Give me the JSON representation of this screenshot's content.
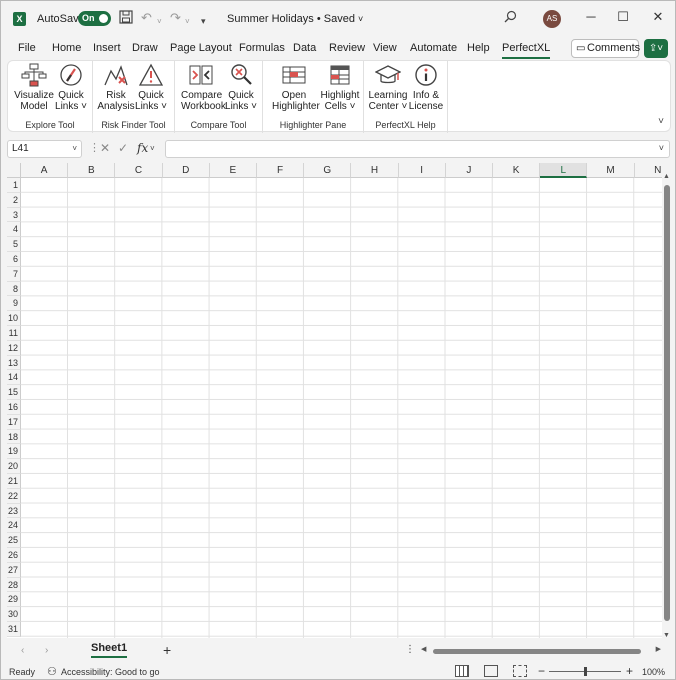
{
  "titlebar": {
    "app_icon": "X",
    "autosave_label": "AutoSave",
    "autosave_state": "On",
    "doc_title": "Summer Holidays • Saved",
    "avatar_initials": "AS",
    "icons": [
      "save-icon",
      "undo-icon",
      "redo-icon",
      "customize-icon",
      "search-icon"
    ]
  },
  "menu": {
    "tabs": [
      "File",
      "Home",
      "Insert",
      "Draw",
      "Page Layout",
      "Formulas",
      "Data",
      "Review",
      "View",
      "Automate",
      "Help",
      "PerfectXL"
    ],
    "active_tab": "PerfectXL",
    "comments_label": "Comments"
  },
  "ribbon": {
    "groups": [
      {
        "label": "Explore Tool",
        "buttons": [
          {
            "line1": "Visualize",
            "line2": "Model",
            "icon": "visualize-model-icon"
          },
          {
            "line1": "Quick",
            "line2": "Links ˅",
            "icon": "compass-icon"
          }
        ]
      },
      {
        "label": "Risk Finder Tool",
        "buttons": [
          {
            "line1": "Risk",
            "line2": "Analysis",
            "icon": "risk-analysis-icon"
          },
          {
            "line1": "Quick",
            "line2": "Links ˅",
            "icon": "warning-icon"
          }
        ]
      },
      {
        "label": "Compare Tool",
        "buttons": [
          {
            "line1": "Compare",
            "line2": "Workbook",
            "icon": "compare-workbook-icon"
          },
          {
            "line1": "Quick",
            "line2": "Links ˅",
            "icon": "magnifier-icon"
          }
        ]
      },
      {
        "label": "Highlighter Pane",
        "buttons": [
          {
            "line1": "Open",
            "line2": "Highlighter",
            "icon": "highlighter-icon"
          },
          {
            "line1": "Highlight",
            "line2": "Cells ˅",
            "icon": "highlight-cells-icon"
          }
        ]
      },
      {
        "label": "PerfectXL Help",
        "buttons": [
          {
            "line1": "Learning",
            "line2": "Center ˅",
            "icon": "graduation-cap-icon"
          },
          {
            "line1": "Info &",
            "line2": "License",
            "icon": "info-icon"
          }
        ]
      }
    ]
  },
  "formula_bar": {
    "name_box": "L41",
    "fx_label": "fx",
    "formula_value": ""
  },
  "grid": {
    "columns": [
      "A",
      "B",
      "C",
      "D",
      "E",
      "F",
      "G",
      "H",
      "I",
      "J",
      "K",
      "L",
      "M",
      "N"
    ],
    "selected_column": "L",
    "rows": [
      "1",
      "2",
      "3",
      "4",
      "5",
      "6",
      "7",
      "8",
      "9",
      "10",
      "11",
      "12",
      "13",
      "14",
      "15",
      "16",
      "17",
      "18",
      "19",
      "20",
      "21",
      "22",
      "23",
      "24",
      "25",
      "26",
      "27",
      "28",
      "29",
      "30",
      "31"
    ]
  },
  "sheets": {
    "tabs": [
      "Sheet1"
    ],
    "active": "Sheet1",
    "add_label": "+"
  },
  "status": {
    "ready": "Ready",
    "accessibility": "Accessibility: Good to go",
    "zoom": "100%",
    "zoom_minus": "−",
    "zoom_plus": "+"
  }
}
